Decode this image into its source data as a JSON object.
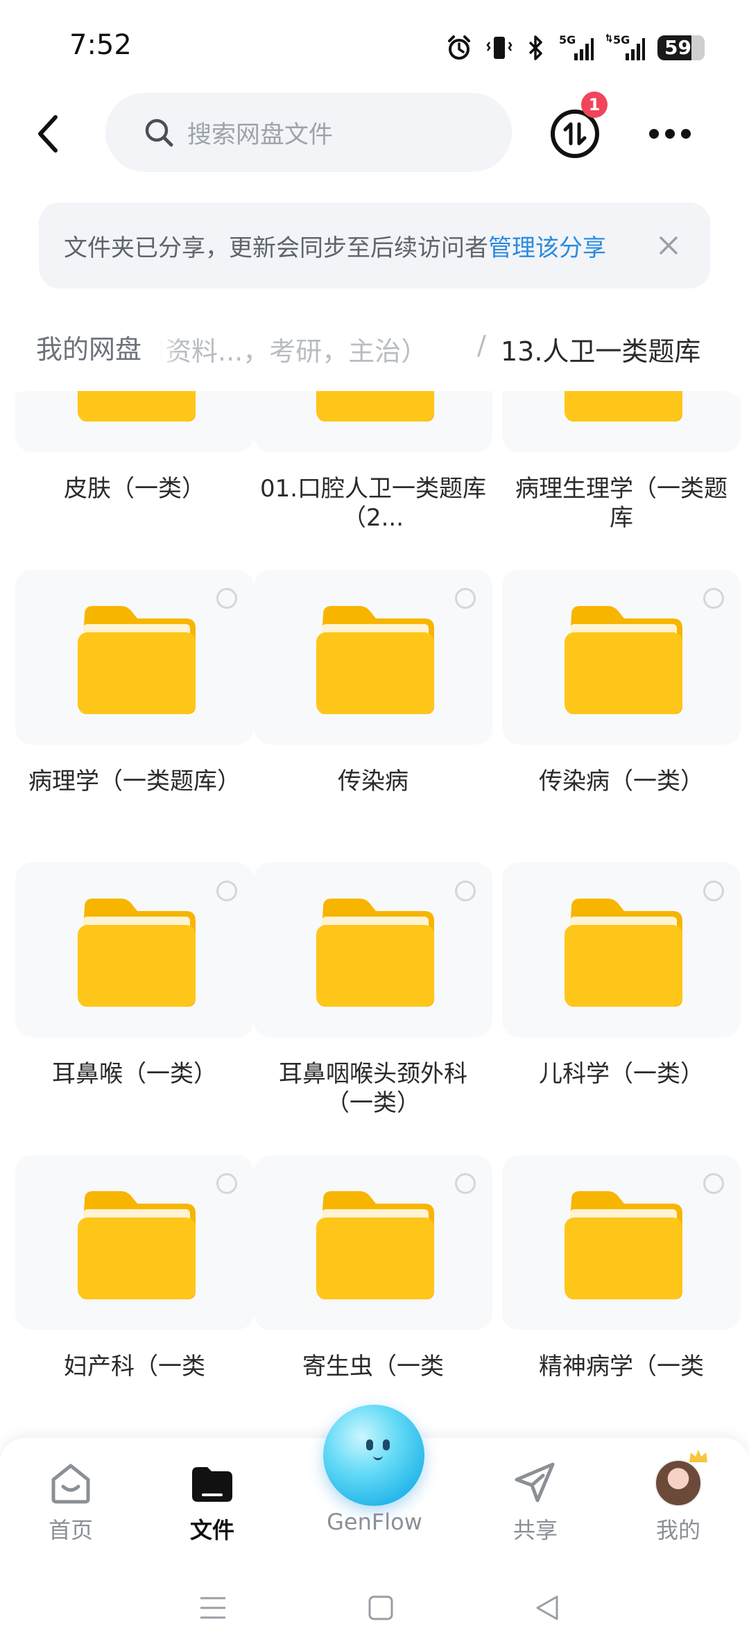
{
  "status_bar": {
    "time": "7:52",
    "battery_level": "59",
    "signal_1_label": "5G",
    "signal_2_label": "5G",
    "icons": [
      "alarm-icon",
      "vibrate-icon",
      "bluetooth-icon",
      "signal-5g-icon",
      "signal-5g-icon",
      "battery-icon"
    ]
  },
  "top_bar": {
    "search_placeholder": "搜索网盘文件",
    "transfer_badge": "1",
    "icons": [
      "back-arrow-icon",
      "search-icon",
      "transfer-icon",
      "more-icon"
    ]
  },
  "share_banner": {
    "message": "文件夹已分享，更新会同步至后续访问者",
    "link": "管理该分享"
  },
  "breadcrumb": {
    "root": "我的网盘",
    "middle": "习资料...，考研，主治）",
    "separator": "/",
    "current": "13.人卫一类题库"
  },
  "folders": [
    {
      "name": "皮肤（一类）"
    },
    {
      "name": "01.口腔人卫一类题库（2..."
    },
    {
      "name": "病理生理学（一类题库"
    },
    {
      "name": "病理学（一类题库）"
    },
    {
      "name": "传染病"
    },
    {
      "name": "传染病（一类）"
    },
    {
      "name": "耳鼻喉（一类）"
    },
    {
      "name": "耳鼻咽喉头颈外科（一类）"
    },
    {
      "name": "儿科学（一类）"
    },
    {
      "name": "妇产科（一类"
    },
    {
      "name": "寄生虫（一类"
    },
    {
      "name": "精神病学（一类"
    }
  ],
  "bottom_nav": {
    "items": [
      {
        "label": "首页",
        "icon": "home-smile-icon"
      },
      {
        "label": "文件",
        "icon": "folder-icon"
      },
      {
        "label": "GenFlow",
        "icon": "genflow-orb-icon"
      },
      {
        "label": "共享",
        "icon": "paper-plane-icon"
      },
      {
        "label": "我的",
        "icon": "avatar-icon"
      }
    ],
    "active": "文件"
  },
  "colors": {
    "accent_link": "#2b8be0",
    "folder_yellow": "#ffc61a",
    "badge_red": "#f2445b",
    "genflow_blue": "#23b5ea"
  }
}
